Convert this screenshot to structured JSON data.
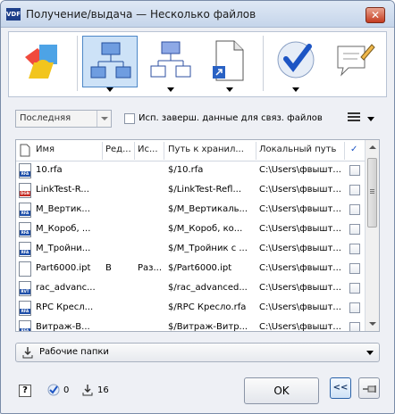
{
  "window": {
    "title": "Получение/выдача — Несколько файлов",
    "app_icon": "VDF",
    "close_label": "✕"
  },
  "ribbon": {
    "buttons": [
      {
        "name": "3d-shapes-icon"
      },
      {
        "name": "network-active-icon",
        "active": true
      },
      {
        "name": "network-icon"
      },
      {
        "name": "document-shortcut-icon"
      },
      {
        "name": "checkmark-icon"
      },
      {
        "name": "note-edit-icon"
      }
    ]
  },
  "options": {
    "version_select": "Последняя",
    "checkbox_label": "Исп. заверш. данные для связ. файлов"
  },
  "grid": {
    "headers": [
      "Имя",
      "Ред...",
      "Ис...",
      "Путь к хранил...",
      "Локальный путь",
      "✓"
    ],
    "rows": [
      {
        "name": "10.rfa",
        "type": "RFA",
        "rev": "",
        "is": "",
        "path": "$/10.rfa",
        "local": "C:\\Users\\фвышт..."
      },
      {
        "name": "LinkTest-R...",
        "type": "DGN",
        "rev": "",
        "is": "",
        "path": "$/LinkTest-Refl...",
        "local": "C:\\Users\\фвышт..."
      },
      {
        "name": "M_Вертик...",
        "type": "RFA",
        "rev": "",
        "is": "",
        "path": "$/M_Вертикаль...",
        "local": "C:\\Users\\фвышт..."
      },
      {
        "name": "M_Короб, ...",
        "type": "RFA",
        "rev": "",
        "is": "",
        "path": "$/M_Короб, ко...",
        "local": "C:\\Users\\фвышт..."
      },
      {
        "name": "M_Тройни...",
        "type": "RFA",
        "rev": "",
        "is": "",
        "path": "$/M_Тройник с ...",
        "local": "C:\\Users\\фвышт..."
      },
      {
        "name": "Part6000.ipt",
        "type": "IPT",
        "rev": "B",
        "is": "Раз...",
        "path": "$/Part6000.ipt",
        "local": "C:\\Users\\фвышт..."
      },
      {
        "name": "rac_advanc...",
        "type": "RVT",
        "rev": "",
        "is": "",
        "path": "$/rac_advanced...",
        "local": "C:\\Users\\фвышт..."
      },
      {
        "name": "RPC Кресл...",
        "type": "RFA",
        "rev": "",
        "is": "",
        "path": "$/RPC Кресло.rfa",
        "local": "C:\\Users\\фвышт..."
      },
      {
        "name": "Витраж-В...",
        "type": "RFA",
        "rev": "",
        "is": "",
        "path": "$/Витраж-Витр...",
        "local": "C:\\Users\\фвышт..."
      }
    ]
  },
  "workfolders": {
    "label": "Рабочие папки"
  },
  "footer": {
    "help": "?",
    "checked_count": "0",
    "download_count": "16",
    "ok_label": "OK",
    "collapse_label": "<<"
  }
}
